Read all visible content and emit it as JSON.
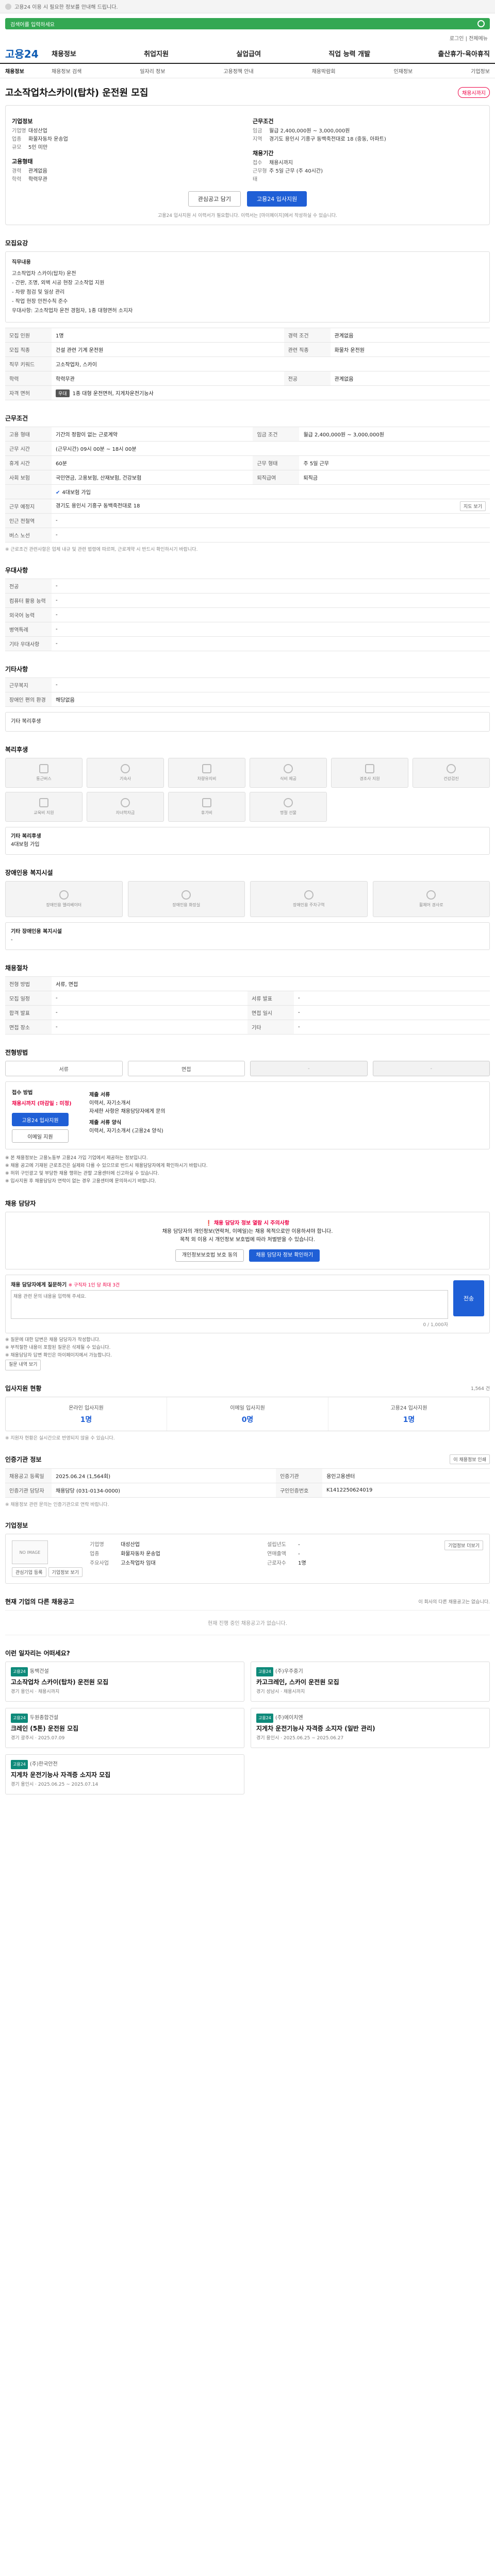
{
  "topbar": {
    "notice": "고용24 이용 시 필요한 정보를 안내해 드립니다."
  },
  "search": {
    "placeholder": "검색어를 입력하세요"
  },
  "util_nav": {
    "login": "로그인",
    "menu": "전체메뉴"
  },
  "gnb": {
    "logo": "고용24",
    "menus": [
      "채용정보",
      "취업지원",
      "실업급여",
      "직업 능력 개발",
      "출산휴가·육아휴직"
    ]
  },
  "subnav": {
    "first": "채용정보",
    "items": [
      "채용정보 검색",
      "일자리 정보",
      "고용정책 안내",
      "채용박람회",
      "인재정보",
      "기업정보"
    ]
  },
  "job": {
    "title": "고소작업차스카이(탑차) 운전원 모집",
    "status_badge": "채용시까지",
    "company_head": "기업정보",
    "company_rows": [
      {
        "k": "기업명",
        "v": "대성산업"
      },
      {
        "k": "업종",
        "v": "화물자동차 운송업"
      },
      {
        "k": "규모",
        "v": "5인 미만"
      }
    ],
    "cond_head": "근무조건",
    "cond_rows": [
      {
        "k": "임금",
        "v": "월급 2,400,000원 ~ 3,000,000원"
      },
      {
        "k": "지역",
        "v": "경기도 용인시 기흥구 동백죽전대로 18 (중동, 아파트)"
      }
    ],
    "emp_head": "고용형태",
    "emp_rows": [
      {
        "k": "경력",
        "v": "관계없음"
      },
      {
        "k": "학력",
        "v": "학력무관"
      }
    ],
    "period_head": "채용기간",
    "period_rows": [
      {
        "k": "접수",
        "v": "채용시까지"
      },
      {
        "k": "근무형태",
        "v": "주 5일 근무 (주 40시간)"
      }
    ],
    "btn_scrap": "관심공고 담기",
    "btn_apply": "고용24 입사지원",
    "note": "고용24 입사지원 시 이력서가 필요합니다. 이력서는 [마이페이지]에서 작성하실 수 있습니다."
  },
  "duty": {
    "title": "모집요강",
    "box_head": "직무내용",
    "lines": [
      "고소작업차 스카이(탑차) 운전",
      "- 간판, 조명, 외벽 시공 현장 고소작업 지원",
      "- 차량 점검 및 일상 관리",
      "- 작업 현장 안전수칙 준수",
      "우대사항: 고소작업차 운전 경험자, 1종 대형면허 소지자"
    ],
    "rows": [
      {
        "k1": "모집 인원",
        "v1": "1명",
        "k2": "경력 조건",
        "v2": "관계없음"
      },
      {
        "k1": "모집 직종",
        "v1": "건설 관련 기계 운전원",
        "k2": "관련 직종",
        "v2": "화물차 운전원"
      },
      {
        "k1": "직무 키워드",
        "v1": "고소작업차, 스카이",
        "k2": "",
        "v2": ""
      },
      {
        "k1": "학력",
        "v1": "학력무관",
        "k2": "전공",
        "v2": "관계없음"
      }
    ],
    "license_label": "자격 면허",
    "license_tag": "우대",
    "license_value": "1종 대형 운전면허, 지게차운전기능사"
  },
  "work": {
    "title": "근무조건",
    "rows": [
      {
        "k1": "고용 형태",
        "v1": "기간의 정함이 없는 근로계약",
        "k2": "임금 조건",
        "v2": "월급 2,400,000원 ~ 3,000,000원"
      },
      {
        "k1": "근무 시간",
        "v1": "(근무시간) 09시 00분 ~ 18시 00분",
        "k2": "",
        "v2": ""
      },
      {
        "k1": "휴게 시간",
        "v1": "60분",
        "k2": "근무 형태",
        "v2": "주 5일 근무"
      },
      {
        "k1": "사회 보험",
        "v1": "국민연금, 고용보험, 산재보험, 건강보험",
        "k2": "퇴직급여",
        "v2": "퇴직금"
      }
    ],
    "insurance_check": "4대보험 가입",
    "location_label": "근무 예정지",
    "location_value": "경기도 용인시 기흥구 동백죽전대로 18",
    "map_btn": "지도 보기",
    "station_label": "인근 전철역",
    "station_value": "-",
    "transit_label": "버스 노선",
    "transit_value": "-",
    "note": "※ 근로조건 관련사항은 업체 내규 및 관련 법령에 따르며, 근로계약 시 반드시 확인하시기 바랍니다."
  },
  "welfare": {
    "title": "우대사항",
    "rows": [
      {
        "k": "전공",
        "v": "-"
      },
      {
        "k": "컴퓨터 활용 능력",
        "v": "-"
      },
      {
        "k": "외국어 능력",
        "v": "-"
      },
      {
        "k": "병역특례",
        "v": "-"
      },
      {
        "k": "기타 우대사항",
        "v": "-"
      }
    ]
  },
  "etc": {
    "title": "기타사항",
    "rows": [
      {
        "k": "근무복지",
        "v": "-"
      },
      {
        "k": "장애인 편의 환경",
        "v": "해당없음"
      }
    ],
    "more": "기타 복리후생"
  },
  "benefits": {
    "title": "복리후생",
    "cards": [
      "통근버스",
      "기숙사",
      "차량유지비",
      "식비 제공",
      "경조사 지원",
      "건강검진",
      "교육비 지원",
      "자녀학자금",
      "휴가비",
      "명절 선물"
    ],
    "more_head": "기타 복리후생",
    "more_value": "4대보험 가입"
  },
  "disabled": {
    "title": "장애인용 복지시설",
    "cards": [
      "장애인용 엘리베이터",
      "장애인용 화장실",
      "장애인용 주차구역",
      "휠체어 경사로"
    ],
    "more_head": "기타 장애인용 복지시설",
    "more_value": "-"
  },
  "recruit": {
    "title": "채용절차",
    "rows": [
      {
        "k1": "전형 방법",
        "v1": "서류, 면접",
        "k2": "",
        "v2": ""
      },
      {
        "k1": "모집 일정",
        "v1": "-",
        "k2": "서류 발표",
        "v2": "-"
      },
      {
        "k1": "합격 발표",
        "v1": "-",
        "k2": "면접 일시",
        "v2": "-"
      },
      {
        "k1": "면접 장소",
        "v1": "-",
        "k2": "기타",
        "v2": "-"
      }
    ]
  },
  "process": {
    "title": "전형방법",
    "steps": [
      "서류",
      "면접",
      "-",
      "-"
    ],
    "apply_head": "접수 방법",
    "apply_deadline": "채용시까지 (마감일 : 미정)",
    "btn_apply": "고용24 입사지원",
    "btn_email": "이메일 지원",
    "doc_head": "제출 서류",
    "doc_value": "이력서, 자기소개서",
    "doc_note": "자세한 사항은 채용담당자에게 문의",
    "req_head": "제출 서류 양식",
    "req_value": "이력서, 자기소개서 (고용24 양식)",
    "bullets": [
      "※ 본 채용정보는 고용노동부 고용24 가입 기업에서 제공하는 정보입니다.",
      "※ 채용 공고에 기재된 근로조건은 실제와 다를 수 있으므로 반드시 채용담당자에게 확인하시기 바랍니다.",
      "※ 허위 구인광고 및 부당한 채용 행위는 관할 고용센터에 신고하실 수 있습니다.",
      "※ 입사지원 후 채용담당자 연락이 없는 경우 고용센터에 문의하시기 바랍니다."
    ]
  },
  "contact": {
    "title": "채용 담당자",
    "alert_head": "채용 담당자 정보 열람 시 주의사항",
    "alert_lines": [
      "채용 담당자의 개인정보(연락처, 이메일)는 채용 목적으로만 이용하셔야 합니다.",
      "목적 외 이용 시 개인정보 보호법에 따라 처벌받을 수 있습니다."
    ],
    "btn_agree": "개인정보보호법 보호 동의",
    "btn_view": "채용 담당자 정보 확인하기",
    "q_label": "채용 담당자에게 질문하기",
    "q_hint": "※ 구직자 1인 당 최대 3건",
    "q_placeholder": "채용 관련 문의 내용을 입력해 주세요.",
    "q_count": "0 / 1,000자",
    "q_send": "전송",
    "notes": [
      "※ 질문에 대한 답변은 채용 담당자가 작성합니다.",
      "※ 부적절한 내용이 포함된 질문은 삭제될 수 있습니다.",
      "※ 채용담당자 답변 확인은 마이페이지에서 가능합니다."
    ],
    "notes_btn": "질문 내역 보기"
  },
  "stats": {
    "title": "입사지원 현황",
    "count_label": "1,564 건",
    "items": [
      {
        "label": "온라인 입사지원",
        "num": "1명"
      },
      {
        "label": "이메일 입사지원",
        "num": "0명"
      },
      {
        "label": "고용24 입사지원",
        "num": "1명"
      }
    ],
    "note": "※ 지원자 현황은 실시간으로 반영되지 않을 수 있습니다."
  },
  "regist": {
    "title": "인증기관 정보",
    "print_btn": "이 채용정보 인쇄",
    "rows": [
      {
        "k1": "채용공고 등록일",
        "v1": "2025.06.24 (1,564회)",
        "k2": "인증기관",
        "v2": "용인고용센터"
      },
      {
        "k1": "인증기관 담당자",
        "v1": "채용담당 (031-0134-0000)",
        "k2": "구인인증번호",
        "v2": "K1412250624019"
      }
    ],
    "map_btn": "지도 보기",
    "note": "※ 채용정보 관련 문의는 인증기관으로 연락 바랍니다."
  },
  "company": {
    "title": "기업정보",
    "logo_text": "NO IMAGE",
    "btn_a": "관심기업 등록",
    "btn_b": "기업정보 보기",
    "rows_left": [
      {
        "k": "기업명",
        "v": "대성산업"
      },
      {
        "k": "업종",
        "v": "화물자동차 운송업"
      },
      {
        "k": "주요사업",
        "v": "고소작업차 임대"
      }
    ],
    "rows_right": [
      {
        "k": "설립년도",
        "v": "-"
      },
      {
        "k": "연매출액",
        "v": "-"
      },
      {
        "k": "근로자수",
        "v": "1명"
      }
    ],
    "detail_btn": "기업정보 더보기"
  },
  "closed": {
    "title": "현재 기업의 다른 채용공고",
    "right_note": "이 회사의 다른 채용공고는 없습니다.",
    "empty": "현재 진행 중인 채용공고가 없습니다."
  },
  "recommend": {
    "title": "이런 일자리는 어떠세요?",
    "items": [
      {
        "label": "고용24",
        "company": "동백건설",
        "title": "고소작업차 스카이(탑차) 운전원 모집",
        "meta": "경기 용인시 · 채용시까지"
      },
      {
        "label": "고용24",
        "company": "(주)우주중기",
        "title": "카고크레인, 스카이 운전원 모집",
        "meta": "경기 성남시 · 채용시까지"
      },
      {
        "label": "고용24",
        "company": "두원종합건설",
        "title": "크레인 (5톤) 운전원 모집",
        "meta": "경기 광주시 · 2025.07.09"
      },
      {
        "label": "고용24",
        "company": "(주)에이치엔",
        "title": "지게차 운전기능사 자격증 소지자 (일반 관리)",
        "meta": "경기 용인시 · 2025.06.25 ~ 2025.06.27"
      },
      {
        "label": "고용24",
        "company": "(주)한국안전",
        "title": "지게차 운전기능사 자격증 소지자 모집",
        "meta": "경기 용인시 · 2025.06.25 ~ 2025.07.14"
      }
    ]
  },
  "colors": {
    "brand": "#0d5bb3",
    "primary": "#1f5fd6",
    "alert": "#e00044",
    "search": "#34a853"
  }
}
